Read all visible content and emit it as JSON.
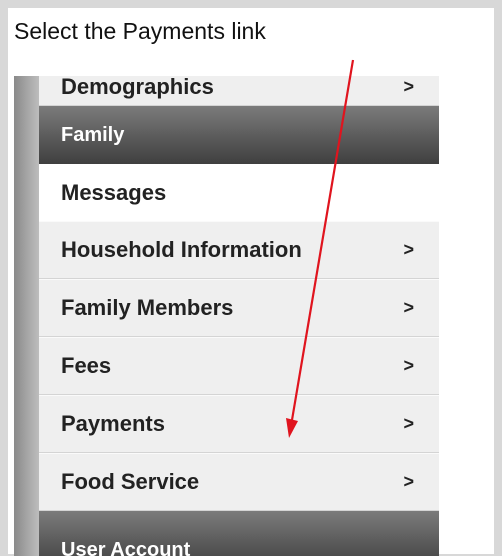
{
  "instruction": "Select the Payments link",
  "menu": {
    "items": [
      {
        "label": "Demographics",
        "chevron": ">"
      },
      {
        "label": "Family"
      },
      {
        "label": "Messages"
      },
      {
        "label": "Household Information",
        "chevron": ">"
      },
      {
        "label": "Family Members",
        "chevron": ">"
      },
      {
        "label": "Fees",
        "chevron": ">"
      },
      {
        "label": "Payments",
        "chevron": ">"
      },
      {
        "label": "Food Service",
        "chevron": ">"
      },
      {
        "label": "User Account"
      }
    ]
  },
  "colors": {
    "arrow": "#e0141e",
    "header": "#555555"
  },
  "icons": {
    "chevron": "chevron-right-icon",
    "arrow": "red-arrow-annotation"
  }
}
